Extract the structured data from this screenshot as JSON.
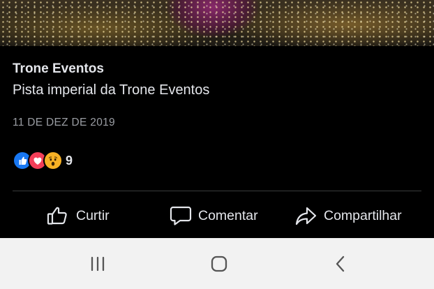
{
  "post": {
    "author": "Trone Eventos",
    "caption": "Pista imperial da Trone Eventos",
    "date": "11 DE DEZ DE 2019",
    "reactions": {
      "icons": [
        "like-icon",
        "love-icon",
        "wow-icon"
      ],
      "count": "9"
    }
  },
  "actions": {
    "like": "Curtir",
    "comment": "Comentar",
    "share": "Compartilhar"
  },
  "navbar": {
    "icons": [
      "recent-apps-icon",
      "home-icon",
      "back-icon"
    ]
  },
  "colors": {
    "background": "#000000",
    "text": "#e4e6eb",
    "muted": "#9a9da3",
    "like_blue": "#1877f2",
    "love_red": "#f33e58",
    "wow_yellow": "#f7b125",
    "navbar": "#f2f2f2"
  }
}
